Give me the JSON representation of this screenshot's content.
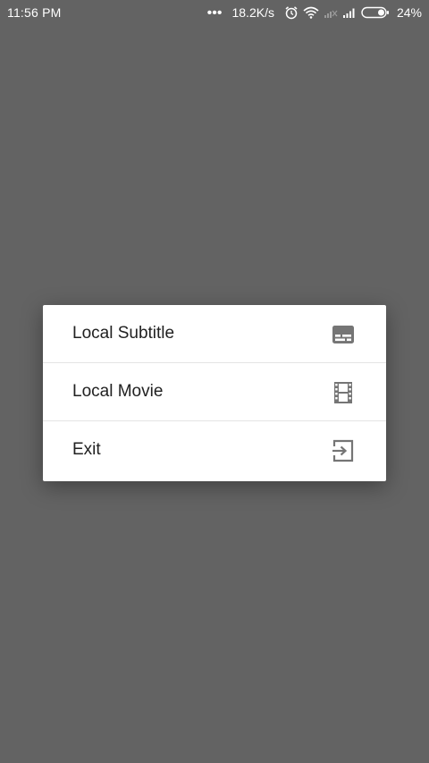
{
  "status_bar": {
    "time": "11:56 PM",
    "dots": "•••",
    "network_speed": "18.2K/s",
    "battery_percent": "24%",
    "battery_level": 0.24,
    "icons": [
      "alarm-icon",
      "wifi-icon",
      "no-signal-icon",
      "signal-icon",
      "battery-icon"
    ]
  },
  "menu": {
    "items": [
      {
        "label": "Local Subtitle",
        "icon": "subtitles-icon"
      },
      {
        "label": "Local Movie",
        "icon": "movie-film-icon"
      },
      {
        "label": "Exit",
        "icon": "exit-icon"
      }
    ]
  },
  "colors": {
    "scrim": "#636363",
    "menu_background": "#ffffff",
    "text": "#212121",
    "icon": "#757575"
  }
}
